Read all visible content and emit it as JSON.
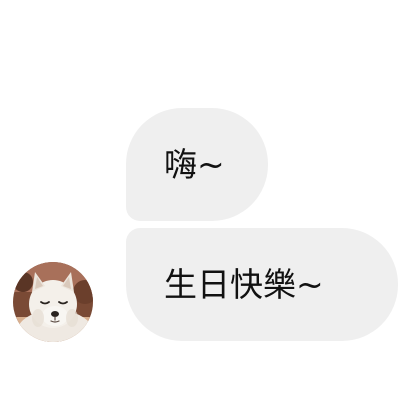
{
  "messages": [
    {
      "text": "嗨~"
    },
    {
      "text": "生日快樂~"
    }
  ],
  "sender": {
    "avatar_icon": "white-dog-avatar"
  },
  "colors": {
    "bubble_bg": "#efefef",
    "text": "#111111",
    "background": "#ffffff"
  }
}
